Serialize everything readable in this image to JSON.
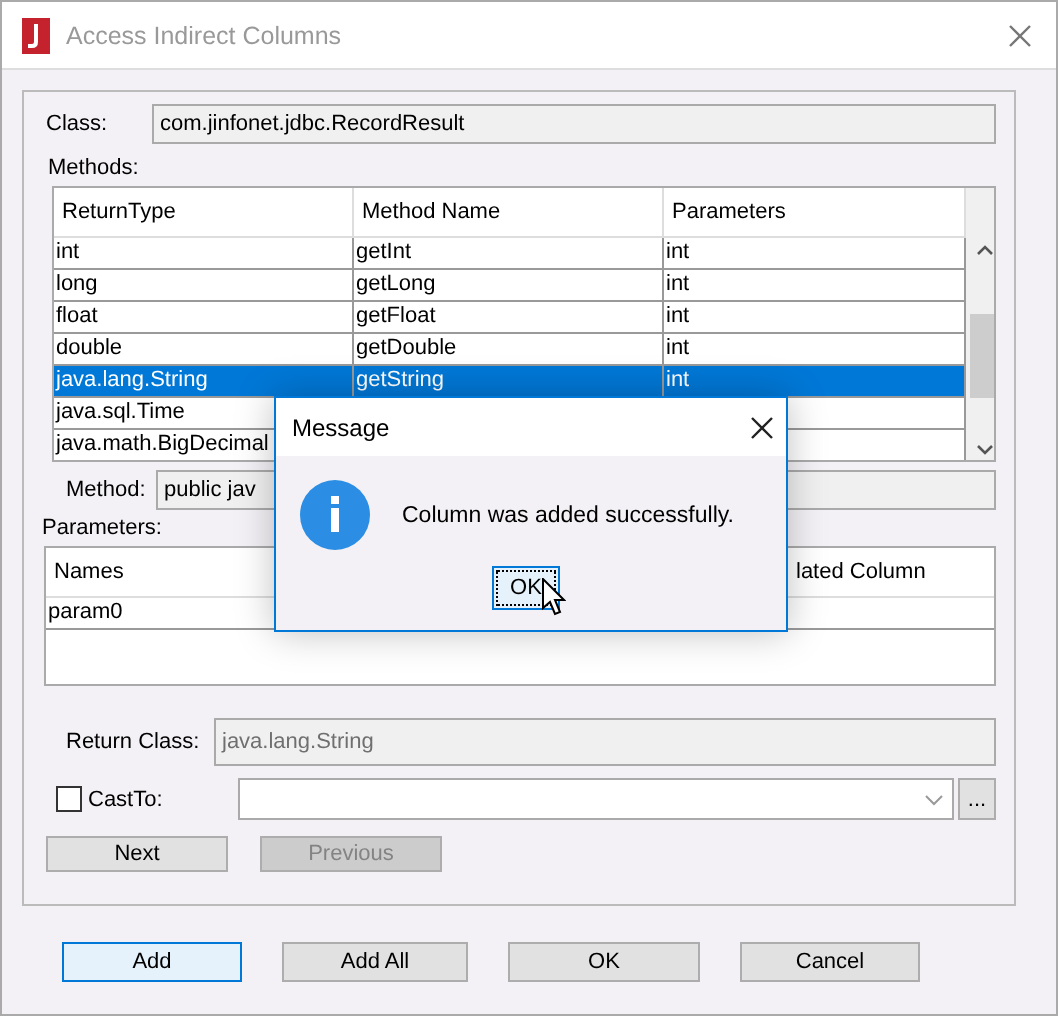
{
  "window": {
    "title": "Access Indirect Columns"
  },
  "class_field": {
    "label": "Class:",
    "value": "com.jinfonet.jdbc.RecordResult"
  },
  "methods": {
    "label": "Methods:",
    "columns": [
      "ReturnType",
      "Method Name",
      "Parameters"
    ],
    "rows": [
      {
        "cells": [
          "int",
          "getInt",
          "int"
        ],
        "selected": false
      },
      {
        "cells": [
          "long",
          "getLong",
          "int"
        ],
        "selected": false
      },
      {
        "cells": [
          "float",
          "getFloat",
          "int"
        ],
        "selected": false
      },
      {
        "cells": [
          "double",
          "getDouble",
          "int"
        ],
        "selected": false
      },
      {
        "cells": [
          "java.lang.String",
          "getString",
          "int"
        ],
        "selected": true
      },
      {
        "cells": [
          "java.sql.Time"
        ],
        "selected": false
      },
      {
        "cells": [
          "java.math.BigDecimal"
        ],
        "selected": false
      }
    ]
  },
  "method_field": {
    "label": "Method:",
    "value": "public jav"
  },
  "parameters": {
    "label": "Parameters:",
    "columns": [
      "Names",
      "lated Column"
    ],
    "rows": [
      [
        "param0"
      ]
    ]
  },
  "return_class": {
    "label": "Return Class:",
    "value": "java.lang.String",
    "disabled": true
  },
  "cast_to": {
    "label": "CastTo:",
    "checked": false,
    "browse": "..."
  },
  "nav_buttons": [
    {
      "label": "Next",
      "disabled": false
    },
    {
      "label": "Previous",
      "disabled": true
    }
  ],
  "footer_buttons": [
    {
      "label": "Add",
      "focused": true
    },
    {
      "label": "Add All",
      "focused": false
    },
    {
      "label": "OK",
      "focused": false
    },
    {
      "label": "Cancel",
      "focused": false
    }
  ],
  "message": {
    "title": "Message",
    "text": "Column was added successfully.",
    "button": "OK"
  }
}
